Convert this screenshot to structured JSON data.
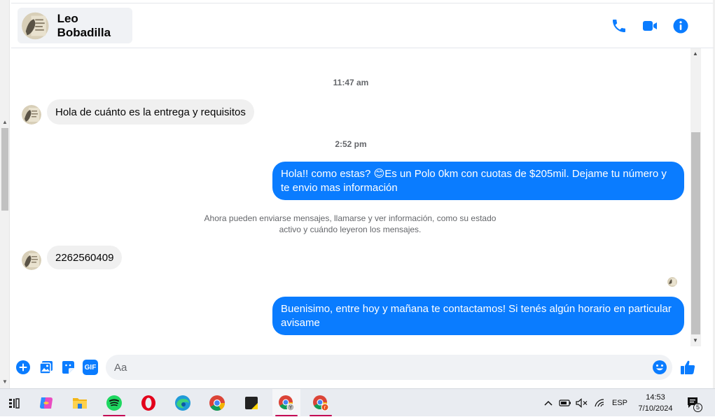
{
  "header": {
    "contact_name": "Leo Bobadilla",
    "icons": [
      "phone-icon",
      "video-icon",
      "info-icon"
    ]
  },
  "messages": [
    {
      "type": "timestamp",
      "text": "11:47 am"
    },
    {
      "type": "incoming",
      "text": "Hola de cuánto es la entrega y requisitos"
    },
    {
      "type": "timestamp",
      "text": "2:52 pm"
    },
    {
      "type": "outgoing",
      "text_before_emoji": "Hola!! como estas? ",
      "emoji": "😊",
      "text_after_emoji": "Es un Polo 0km con cuotas de $205mil. Dejame tu número y te envio mas información"
    },
    {
      "type": "system",
      "text": "Ahora pueden enviarse mensajes, llamarse y ver información, como su estado activo y cuándo leyeron los mensajes."
    },
    {
      "type": "incoming",
      "text": "2262560409"
    },
    {
      "type": "outgoing",
      "text": "Buenisimo, entre hoy y mañana te contactamos! Si tenés algún horario en particular avisame"
    }
  ],
  "composer": {
    "placeholder": "Aa",
    "actions": [
      "plus-icon",
      "photo-icon",
      "sticker-icon",
      "gif-icon"
    ],
    "gif_label": "GIF"
  },
  "taskbar": {
    "apps": [
      "task-view",
      "copilot",
      "file-explorer",
      "spotify",
      "opera",
      "edge",
      "chrome",
      "sticky-notes",
      "chrome-profile-y",
      "chrome-profile-r"
    ],
    "language": "ESP",
    "time": "14:53",
    "date": "7/10/2024",
    "notification_count": "5"
  },
  "colors": {
    "accent": "#0a7cff",
    "incoming_bubble": "#f0f0f0",
    "taskbar": "#e9ecf1"
  }
}
